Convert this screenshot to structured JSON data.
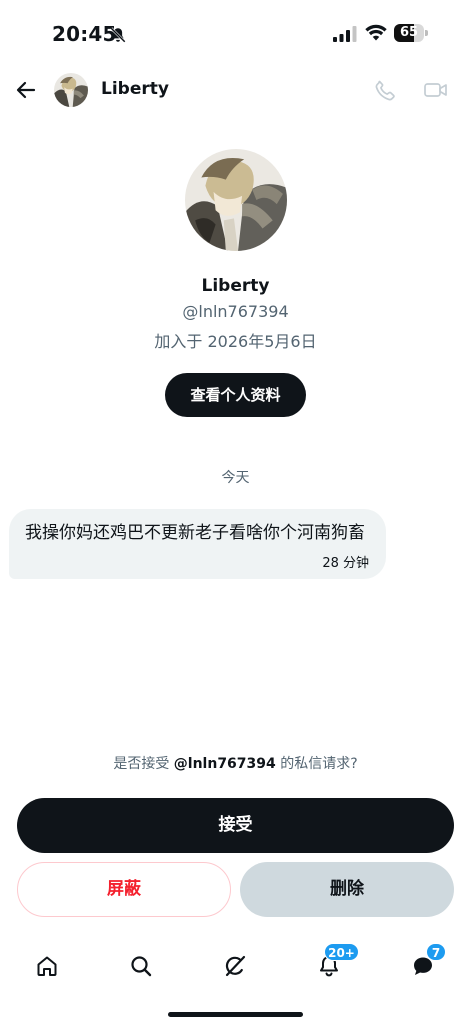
{
  "status_bar": {
    "time": "20:45",
    "battery_level": "65",
    "battery_fraction": 0.65,
    "icons": [
      "bell-off-icon",
      "cellular-signal-icon",
      "wifi-icon",
      "battery-icon"
    ]
  },
  "header": {
    "name": "Liberty",
    "icons": [
      "back-arrow-icon",
      "phone-icon",
      "video-camera-icon"
    ]
  },
  "profile": {
    "name": "Liberty",
    "handle": "@lnln767394",
    "joined": "加入于 2026年5月6日",
    "view_profile_label": "查看个人资料"
  },
  "conversation": {
    "date_divider": "今天",
    "messages": [
      {
        "text": "我操你妈还鸡巴不更新老子看啥你个河南狗畜",
        "time": "28 分钟"
      }
    ]
  },
  "request": {
    "prompt_prefix": "是否接受 ",
    "prompt_handle": "@lnln767394",
    "prompt_suffix": " 的私信请求?",
    "accept_label": "接受",
    "block_label": "屏蔽",
    "delete_label": "删除"
  },
  "bottom_nav": {
    "items": [
      "home-icon",
      "search-icon",
      "grok-icon",
      "notifications-icon",
      "messages-icon"
    ],
    "notifications_badge": "20+",
    "messages_badge": "7"
  },
  "colors": {
    "primary_dark": "#0f1419",
    "secondary_text": "#536471",
    "bubble_bg": "#eff3f4",
    "danger": "#f4212e",
    "accent_blue": "#1d9bf0",
    "delete_bg": "#cfd9de"
  }
}
